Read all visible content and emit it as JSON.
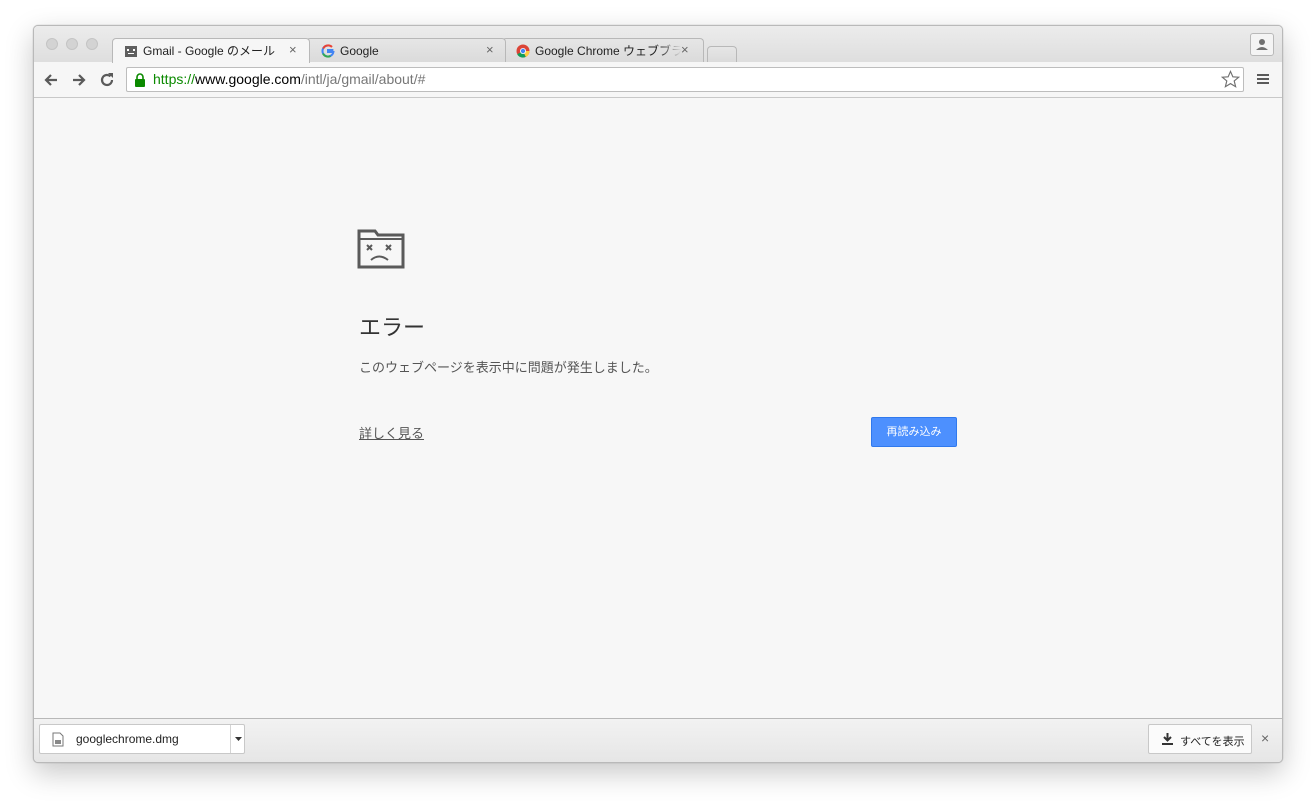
{
  "tabs": [
    {
      "title": "Gmail - Google のメール",
      "active": true
    },
    {
      "title": "Google",
      "active": false
    },
    {
      "title": "Google Chrome ウェブブラウザ",
      "active": false
    }
  ],
  "tab_close_glyph": "×",
  "omnibox": {
    "scheme": "https://",
    "host": "www.google.com",
    "path": "/intl/ja/gmail/about/#"
  },
  "error_page": {
    "title": "エラー",
    "message": "このウェブページを表示中に問題が発生しました。",
    "details_link": "詳しく見る",
    "reload_button": "再読み込み"
  },
  "download_shelf": {
    "file_name": "googlechrome.dmg",
    "show_all": "すべてを表示",
    "close_glyph": "×"
  },
  "colors": {
    "secure_green": "#0b8a00",
    "reload_blue": "#4d90fe"
  },
  "icons": [
    "back-arrow-icon",
    "forward-arrow-icon",
    "reload-icon",
    "lock-icon",
    "star-icon",
    "menu-icon",
    "profile-icon",
    "sad-folder-icon",
    "file-icon",
    "download-icon"
  ]
}
